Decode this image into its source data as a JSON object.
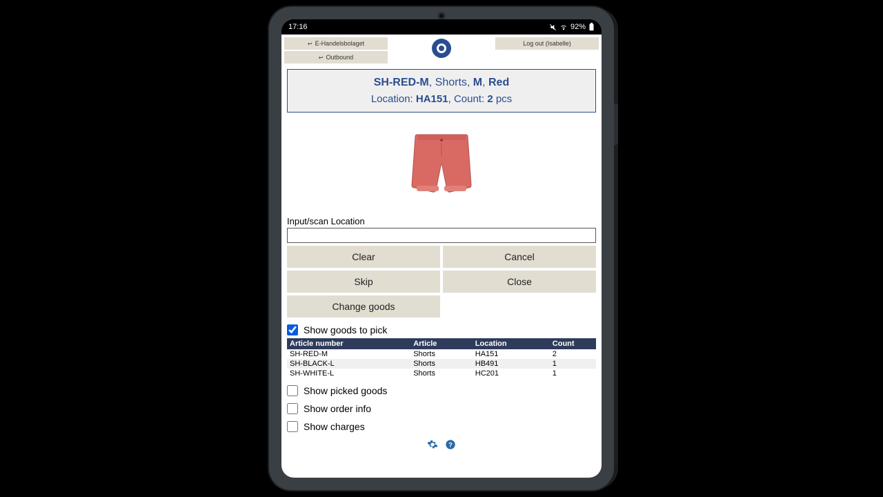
{
  "status": {
    "time": "17:16",
    "battery": "92%"
  },
  "nav": {
    "company": "E-Handelsbolaget",
    "section": "Outbound",
    "logout": "Log out (Isabelle)"
  },
  "summary": {
    "sku": "SH-RED-M",
    "article": "Shorts",
    "size": "M",
    "color": "Red",
    "location_label": "Location:",
    "location": "HA151",
    "count_label": "Count:",
    "count": "2",
    "unit": "pcs"
  },
  "scan": {
    "label": "Input/scan Location",
    "value": ""
  },
  "buttons": {
    "clear": "Clear",
    "cancel": "Cancel",
    "skip": "Skip",
    "close": "Close",
    "change": "Change goods"
  },
  "checks": {
    "show_goods": "Show goods to pick",
    "show_picked": "Show picked goods",
    "show_order": "Show order info",
    "show_charges": "Show charges"
  },
  "table": {
    "headers": {
      "article_no": "Article number",
      "article": "Article",
      "location": "Location",
      "count": "Count"
    },
    "rows": [
      {
        "article_no": "SH-RED-M",
        "article": "Shorts",
        "location": "HA151",
        "count": "2"
      },
      {
        "article_no": "SH-BLACK-L",
        "article": "Shorts",
        "location": "HB491",
        "count": "1"
      },
      {
        "article_no": "SH-WHITE-L",
        "article": "Shorts",
        "location": "HC201",
        "count": "1"
      }
    ]
  }
}
